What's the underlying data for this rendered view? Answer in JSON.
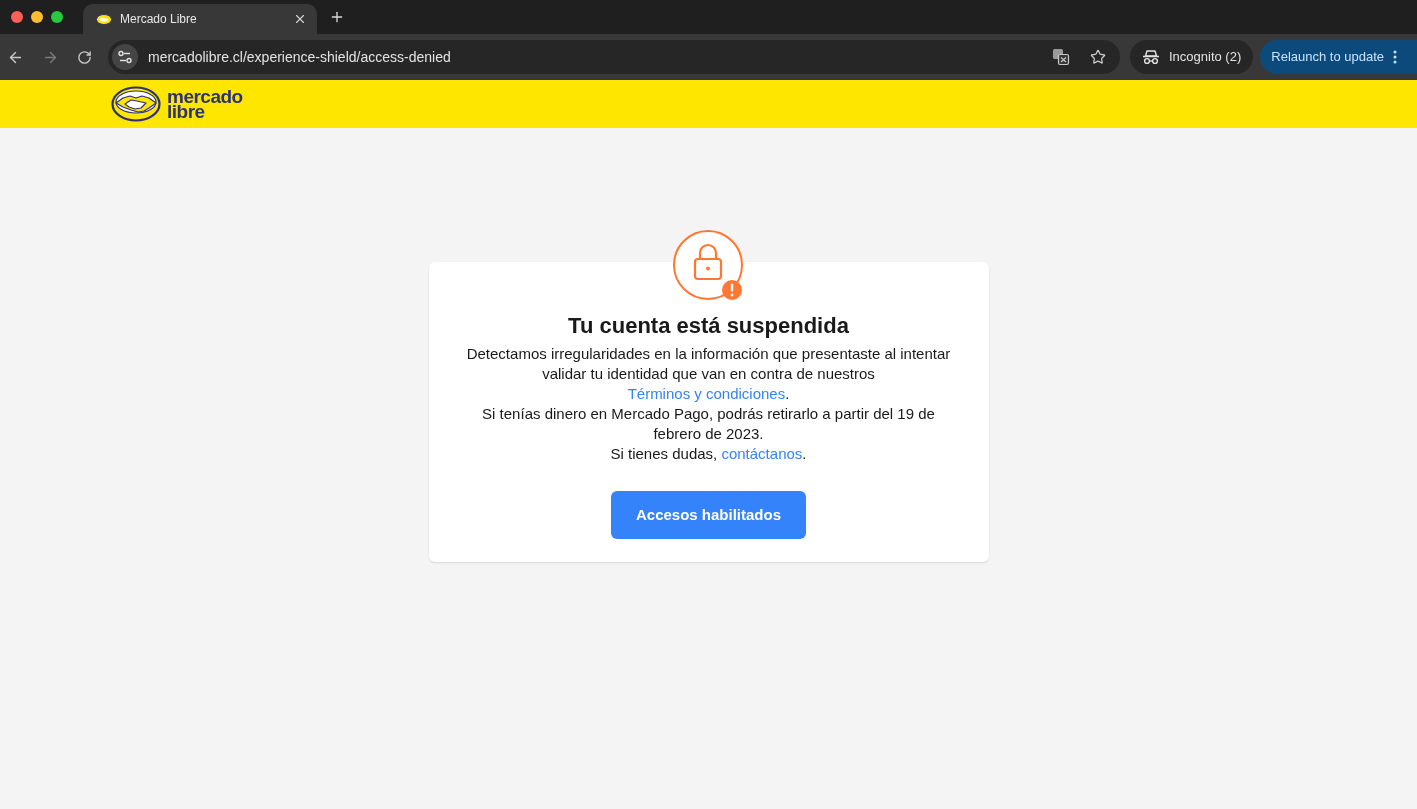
{
  "browser": {
    "tabs": [
      {
        "title": "Mercado Libre",
        "selected": true
      }
    ],
    "address_bar": {
      "url": "mercadolibre.cl/experience-shield/access-denied"
    },
    "incognito": {
      "label": "Incognito (2)"
    },
    "update_button": {
      "label": "Relaunch to update"
    }
  },
  "header": {
    "logo": {
      "line_1": "mercado",
      "line_2": "libre"
    }
  },
  "card": {
    "title": "Tu cuenta está suspendida",
    "paragraphs": [
      {
        "text": "Detectamos irregularidades en la información que presentaste al intentar validar tu identidad que van en contra de nuestros ",
        "link": "Términos y condiciones",
        "after": "."
      },
      {
        "text": "Si tenías dinero en Mercado Pago, podrás retirarlo a partir del 19 de febrero de 2023."
      },
      {
        "text": "Si tienes dudas, ",
        "link": "contáctanos",
        "after": "."
      }
    ],
    "button": {
      "label": "Accesos habilitados"
    }
  }
}
